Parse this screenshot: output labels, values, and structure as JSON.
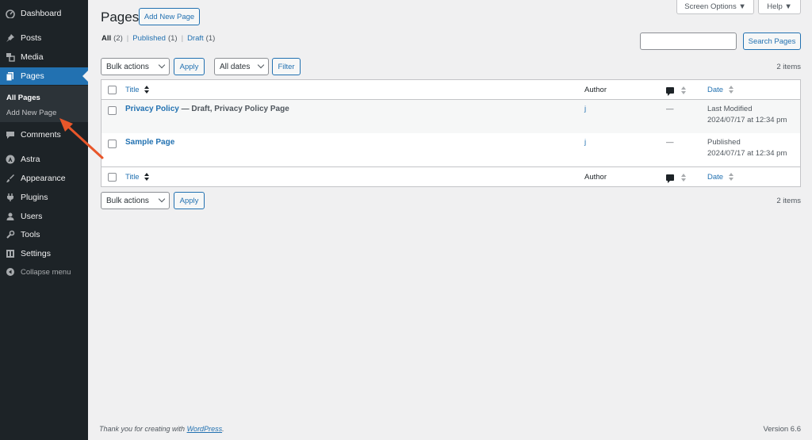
{
  "sidebar": {
    "items": [
      {
        "label": "Dashboard",
        "icon": "dashboard-icon"
      },
      {
        "label": "Posts",
        "icon": "pin-icon"
      },
      {
        "label": "Media",
        "icon": "media-icon"
      },
      {
        "label": "Pages",
        "icon": "pages-icon"
      },
      {
        "label": "Comments",
        "icon": "comment-icon"
      },
      {
        "label": "Astra",
        "icon": "astra-icon"
      },
      {
        "label": "Appearance",
        "icon": "brush-icon"
      },
      {
        "label": "Plugins",
        "icon": "plug-icon"
      },
      {
        "label": "Users",
        "icon": "user-icon"
      },
      {
        "label": "Tools",
        "icon": "wrench-icon"
      },
      {
        "label": "Settings",
        "icon": "settings-icon"
      }
    ],
    "submenu": {
      "all_pages": "All Pages",
      "add_new_page": "Add New Page"
    },
    "collapse": "Collapse menu"
  },
  "top": {
    "screen_options": "Screen Options ▼",
    "help": "Help ▼"
  },
  "header": {
    "title": "Pages",
    "add_new": "Add New Page"
  },
  "filters": {
    "all": "All",
    "all_count": "(2)",
    "published": "Published",
    "published_count": "(1)",
    "draft": "Draft",
    "draft_count": "(1)"
  },
  "search": {
    "button": "Search Pages",
    "value": ""
  },
  "bulk": {
    "bulk_actions": "Bulk actions",
    "apply": "Apply",
    "all_dates": "All dates",
    "filter": "Filter"
  },
  "items_count": "2 items",
  "table": {
    "columns": {
      "title": "Title",
      "author": "Author",
      "date": "Date"
    },
    "rows": [
      {
        "title": "Privacy Policy",
        "state": " — Draft, Privacy Policy Page",
        "author": "j",
        "comments": "—",
        "date_status": "Last Modified",
        "date_value": "2024/07/17 at 12:34 pm"
      },
      {
        "title": "Sample Page",
        "state": "",
        "author": "j",
        "comments": "—",
        "date_status": "Published",
        "date_value": "2024/07/17 at 12:34 pm"
      }
    ]
  },
  "footer": {
    "thanks": "Thank you for creating with ",
    "wp_link": "WordPress",
    "period": ".",
    "version": "Version 6.6"
  },
  "colors": {
    "accent": "#2271b1",
    "sidebar": "#1d2327",
    "annotation_arrow": "#e8562a"
  }
}
